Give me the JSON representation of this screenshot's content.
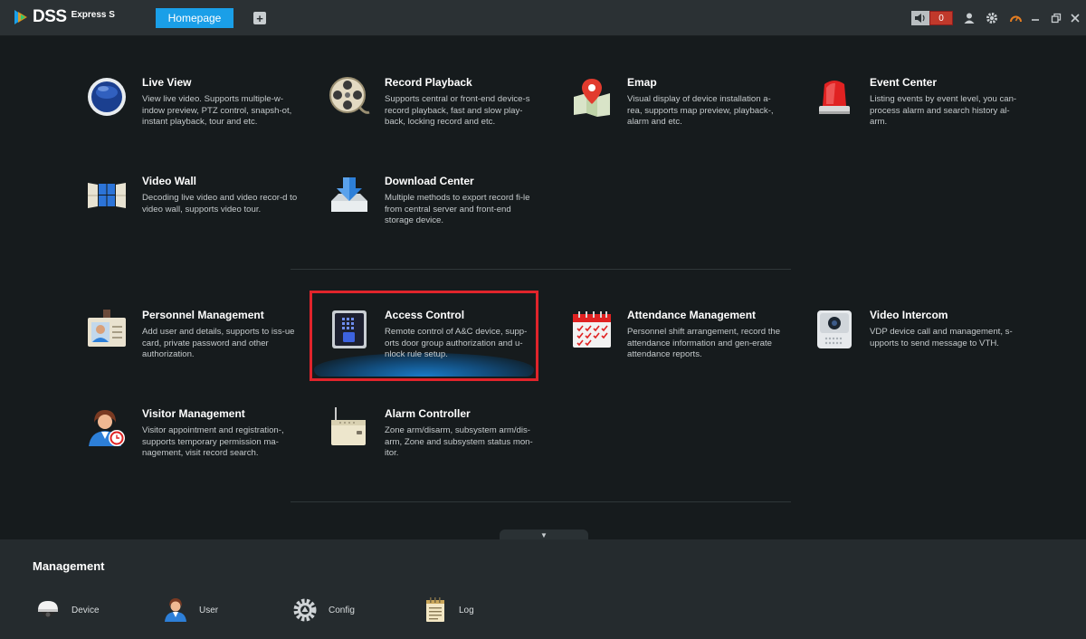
{
  "app": {
    "logo_text": "DSS",
    "logo_sub": "Express S",
    "tab_home": "Homepage",
    "tab_add": "+",
    "alarm_count": "0"
  },
  "modules": [
    {
      "title": "Live View",
      "desc": "View live video. Supports multiple-w-indow preview, PTZ control, snapsh-ot, instant playback, tour and etc.",
      "icon": "globe-icon"
    },
    {
      "title": "Record Playback",
      "desc": "Supports central or front-end device-s record playback, fast and slow play-back, locking record and etc.",
      "icon": "film-reel-icon"
    },
    {
      "title": "Emap",
      "desc": "Visual display of device installation a-rea, supports map preview, playback-, alarm and etc.",
      "icon": "map-pin-icon"
    },
    {
      "title": "Event Center",
      "desc": "Listing events by event level, you can-process alarm and search history al-arm.",
      "icon": "alarm-light-icon"
    },
    {
      "title": "Video Wall",
      "desc": "Decoding live video and video recor-d to video wall, supports video tour.",
      "icon": "video-wall-icon"
    },
    {
      "title": "Download Center",
      "desc": "Multiple methods to export record fi-le from central server and front-end storage device.",
      "icon": "download-icon"
    },
    {
      "title": "Personnel Management",
      "desc": "Add user and details, supports to iss-ue card, private password and other authorization.",
      "icon": "id-card-icon"
    },
    {
      "title": "Access Control",
      "desc": "Remote control of A&C device, supp-orts door group authorization and u-nlock rule setup.",
      "icon": "access-device-icon"
    },
    {
      "title": "Attendance Management",
      "desc": "Personnel shift arrangement, record the attendance information and gen-erate attendance reports.",
      "icon": "calendar-icon"
    },
    {
      "title": "Video Intercom",
      "desc": "VDP device call and management, s-upports to send message to VTH.",
      "icon": "intercom-icon"
    },
    {
      "title": "Visitor Management",
      "desc": "Visitor appointment and registration-, supports temporary permission ma-nagement, visit record search.",
      "icon": "visitor-icon"
    },
    {
      "title": "Alarm Controller",
      "desc": "Zone arm/disarm, subsystem arm/dis-arm, Zone and subsystem status mon-itor.",
      "icon": "alarm-controller-icon"
    }
  ],
  "management": {
    "title": "Management",
    "items": [
      {
        "label": "Device",
        "icon": "camera-dome-icon"
      },
      {
        "label": "User",
        "icon": "user-icon"
      },
      {
        "label": "Config",
        "icon": "gear-icon"
      },
      {
        "label": "Log",
        "icon": "notepad-icon"
      }
    ]
  },
  "colors": {
    "accent": "#1a9fe8",
    "highlight": "#e0242b"
  }
}
